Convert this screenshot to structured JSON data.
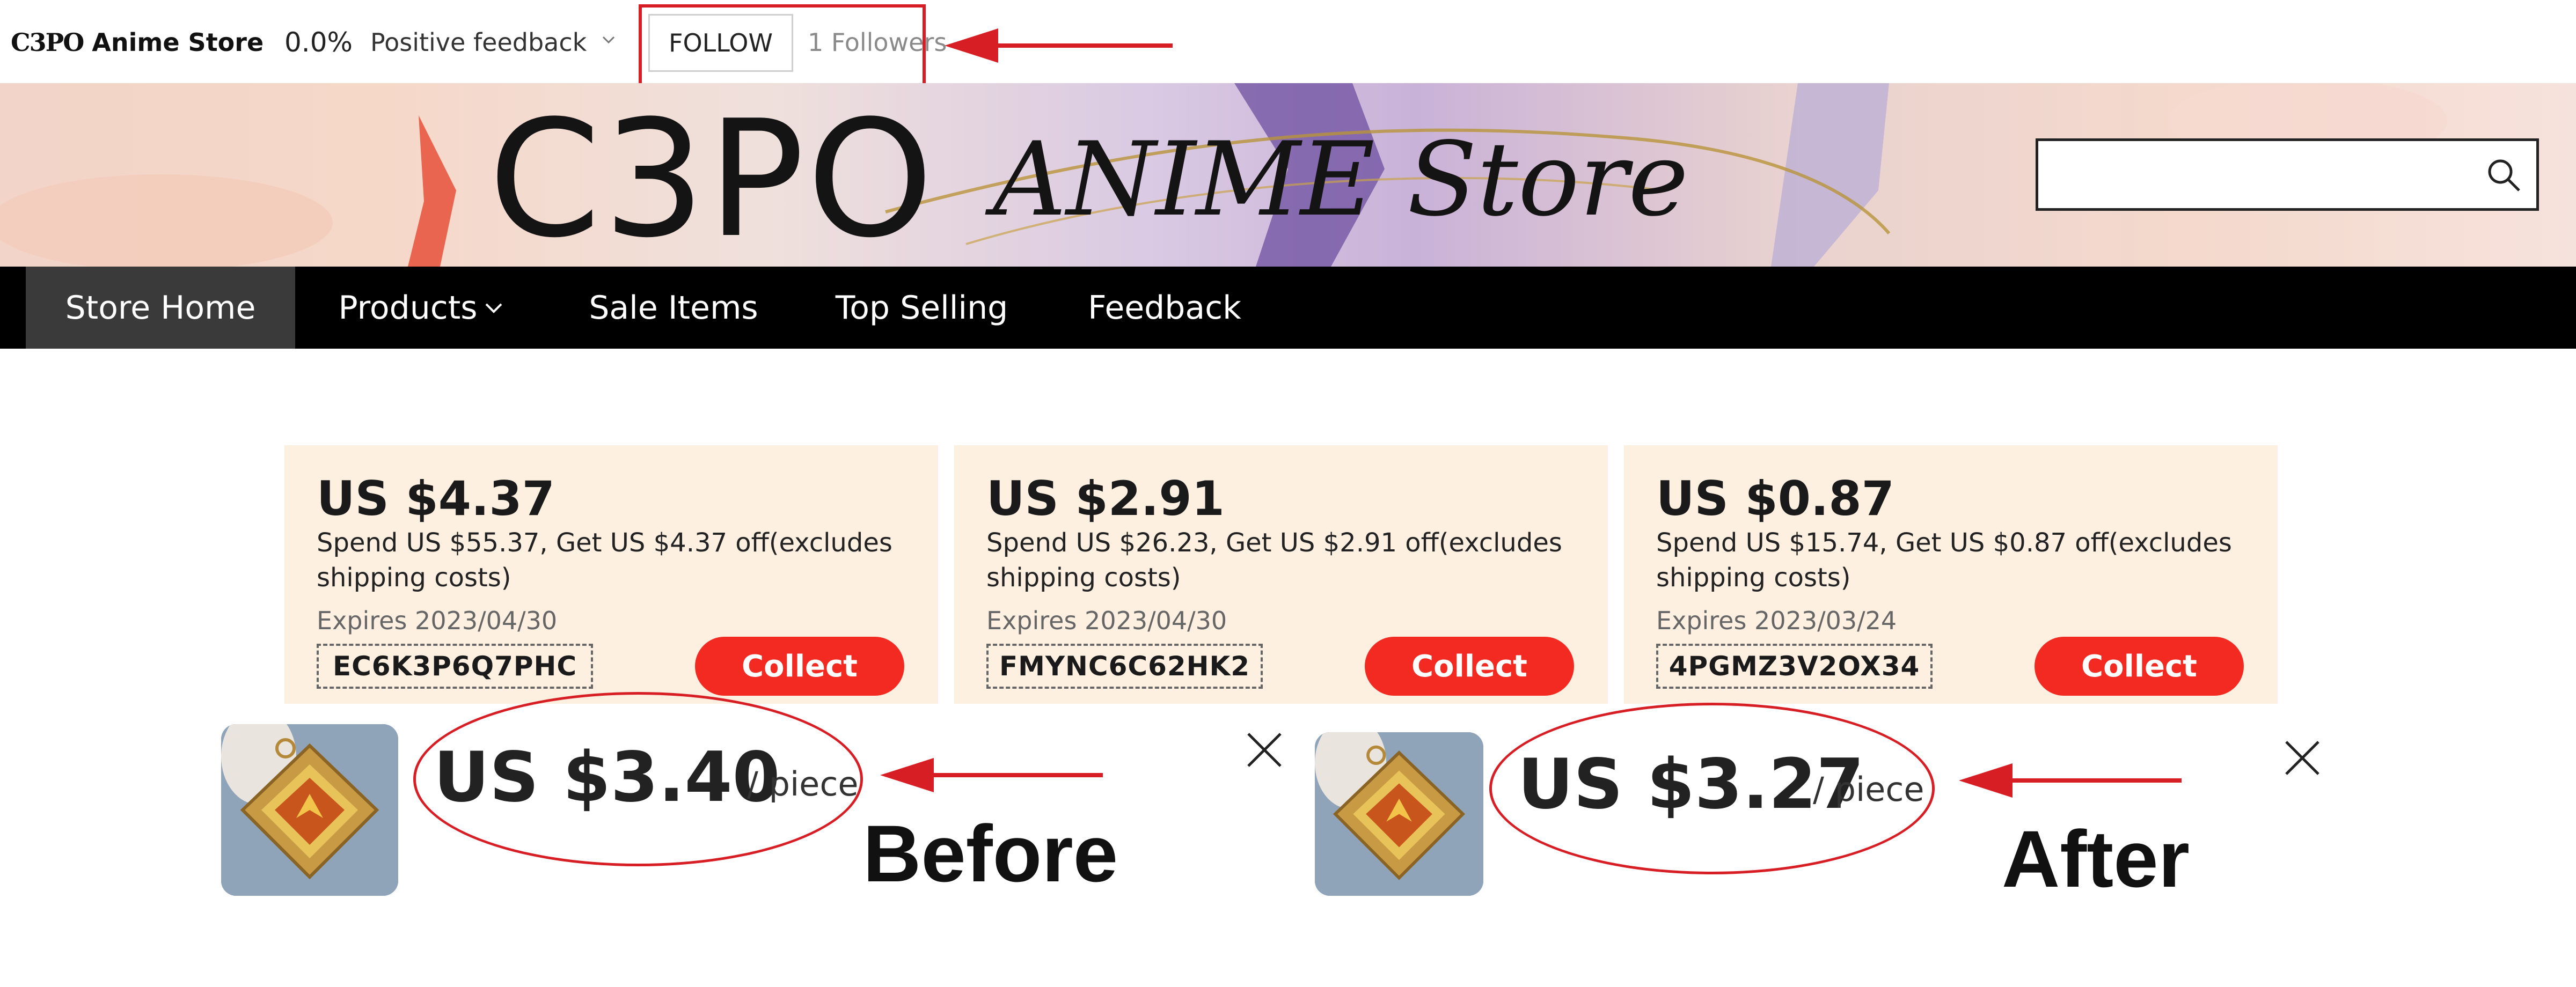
{
  "header": {
    "store_name": "Anime Store",
    "store_logo_mark": "C3PO",
    "feedback_percent": "0.0%",
    "feedback_label": "Positive feedback",
    "follow_label": "FOLLOW",
    "followers": "1 Followers"
  },
  "banner": {
    "title": "C3PO",
    "subtitle": "ANIME Store",
    "search_placeholder": ""
  },
  "nav": {
    "items": [
      {
        "label": "Store Home",
        "active": true
      },
      {
        "label": "Products",
        "has_dropdown": true
      },
      {
        "label": "Sale Items"
      },
      {
        "label": "Top Selling"
      },
      {
        "label": "Feedback"
      }
    ]
  },
  "coupons": [
    {
      "amount": "US $4.37",
      "description": "Spend US $55.37, Get US $4.37 off(excludes shipping costs)",
      "expires": "Expires 2023/04/30",
      "code": "EC6K3P6Q7PHC",
      "button": "Collect"
    },
    {
      "amount": "US $2.91",
      "description": "Spend US $26.23, Get US $2.91 off(excludes shipping costs)",
      "expires": "Expires 2023/04/30",
      "code": "FMYNC6C62HK2",
      "button": "Collect"
    },
    {
      "amount": "US $0.87",
      "description": "Spend US $15.74, Get US $0.87 off(excludes shipping costs)",
      "expires": "Expires 2023/03/24",
      "code": "4PGMZ3V2OX34",
      "button": "Collect"
    }
  ],
  "comparison": {
    "before": {
      "price": "US $3.40",
      "unit": "/ piece",
      "label": "Before"
    },
    "after": {
      "price": "US $3.27",
      "unit": "/ piece",
      "label": "After"
    }
  },
  "colors": {
    "accent_red": "#f22a22",
    "annotation_red": "#d81e25",
    "nav_bg": "#000000",
    "coupon_bg": "#fdf0e0"
  },
  "icons": {
    "search": "search-icon",
    "close": "close-icon",
    "dropdown": "chevron-down-icon",
    "arrow": "arrow-left-icon"
  }
}
